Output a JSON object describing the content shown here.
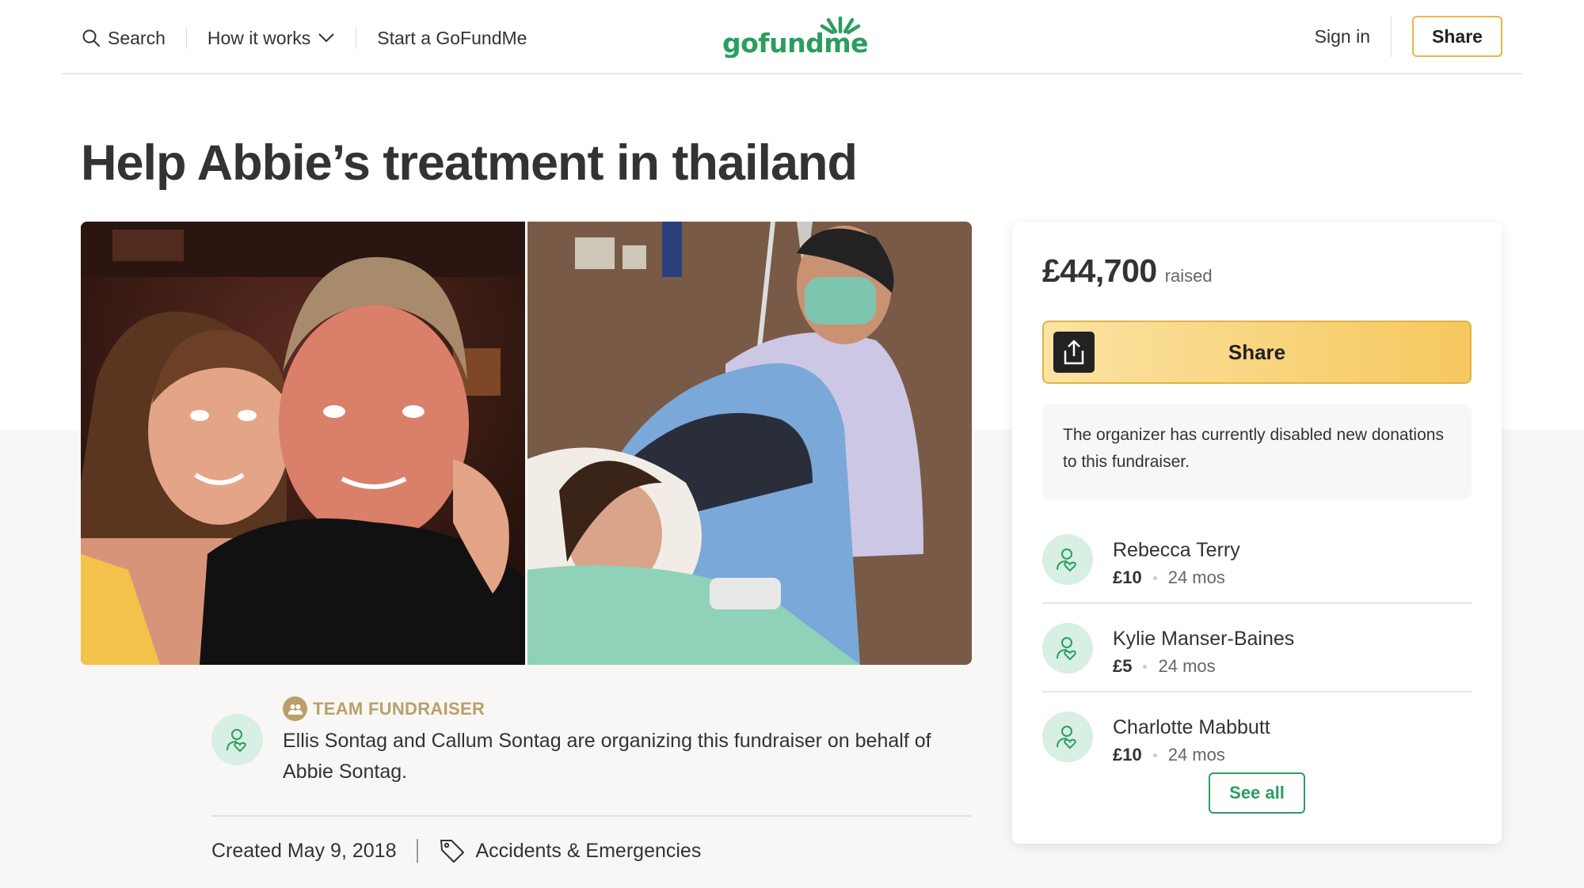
{
  "header": {
    "search_label": "Search",
    "how_it_works_label": "How it works",
    "start_label": "Start a GoFundMe",
    "logo_text": "gofundme",
    "sign_in_label": "Sign in",
    "share_label": "Share"
  },
  "campaign": {
    "title": "Help Abbie’s treatment in thailand"
  },
  "organizer": {
    "team_label": "TEAM FUNDRAISER",
    "description": "Ellis Sontag and Callum Sontag are organizing this fundraiser on behalf of Abbie Sontag.",
    "created": "Created May 9, 2018",
    "category": "Accidents & Emergencies"
  },
  "sidebar": {
    "raised_amount": "£44,700",
    "raised_label": "raised",
    "share_label": "Share",
    "notice": "The organizer has currently disabled new donations to this fundraiser.",
    "donations": [
      {
        "name": "Rebecca Terry",
        "amount": "£10",
        "time": "24 mos"
      },
      {
        "name": "Kylie Manser-Baines",
        "amount": "£5",
        "time": "24 mos"
      },
      {
        "name": "Charlotte Mabbutt",
        "amount": "£10",
        "time": "24 mos"
      }
    ],
    "see_all_label": "See all"
  },
  "colors": {
    "brand_green": "#2b9e5f",
    "share_gold": "#f6c85e",
    "team_gold": "#b9a06a"
  },
  "icons": [
    "search-icon",
    "chevron-down-icon",
    "upload-icon",
    "user-heart-icon",
    "team-icon",
    "tag-icon"
  ]
}
